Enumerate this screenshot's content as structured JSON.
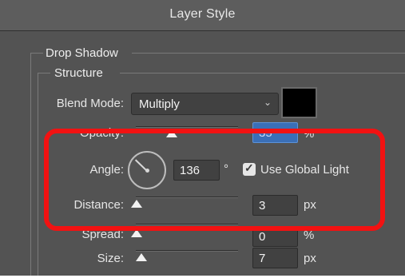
{
  "window": {
    "title": "Layer Style"
  },
  "drop_shadow": {
    "legend": "Drop Shadow"
  },
  "structure": {
    "legend": "Structure"
  },
  "blend_mode": {
    "label": "Blend Mode:",
    "value": "Multiply",
    "color": "#000000"
  },
  "opacity": {
    "label": "Opacity:",
    "value": "35",
    "unit": "%",
    "level": 0.35
  },
  "angle": {
    "label": "Angle:",
    "value": "136",
    "unit": "°",
    "global_light_label": "Use Global Light",
    "global_light_checked": true
  },
  "distance": {
    "label": "Distance:",
    "value": "3",
    "unit": "px"
  },
  "spread": {
    "label": "Spread:",
    "value": "0",
    "unit": "%"
  },
  "size": {
    "label": "Size:",
    "value": "7",
    "unit": "px"
  },
  "annotation": {
    "color": "#f21212"
  }
}
